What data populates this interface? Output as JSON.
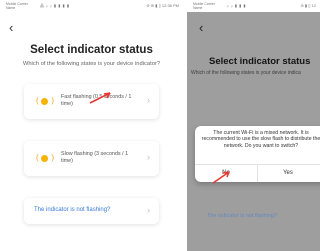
{
  "left": {
    "status_bar": {
      "carrier": "Mobile Carrier Name",
      "icons": "⁂ ᵢₗ ᵢₗ ▮ ▮ ▮ ▮",
      "time": "⊘ ⊛ ▮ ▯ 12:38 PM"
    },
    "title": "Select indicator status",
    "subtitle": "Which of the following states is your device indicator?",
    "options": [
      {
        "label": "Fast flashing (0.5 seconds / 1 time)"
      },
      {
        "label": "Slow flashing (3 seconds / 1 time)"
      }
    ],
    "not_flashing_link": "The indicator is not flashing?"
  },
  "right": {
    "status_bar": {
      "carrier": "Mobile Carrier Name",
      "icons": "ᵢₗ ᵢₗ ▮ ▮ ▮",
      "time": "⊘ ▮ ▯ 12"
    },
    "title": "Select indicator status",
    "subtitle": "Which of the following states is your device indica",
    "dialog": {
      "message": "The current Wi-Fi is a mixed network. It is recommended to use the slow flash to distribute the network. Do you want to switch?",
      "no_label": "No",
      "yes_label": "Yes"
    },
    "not_flashing_link": "The indicator is not flashing?"
  },
  "icons": {
    "back": "back-chevron-icon",
    "chevron": "chevron-right-icon",
    "indicator": "indicator-led-icon"
  },
  "colors": {
    "accent": "#3a7bd5",
    "led": "#f5b400",
    "annotation": "#e53935"
  }
}
